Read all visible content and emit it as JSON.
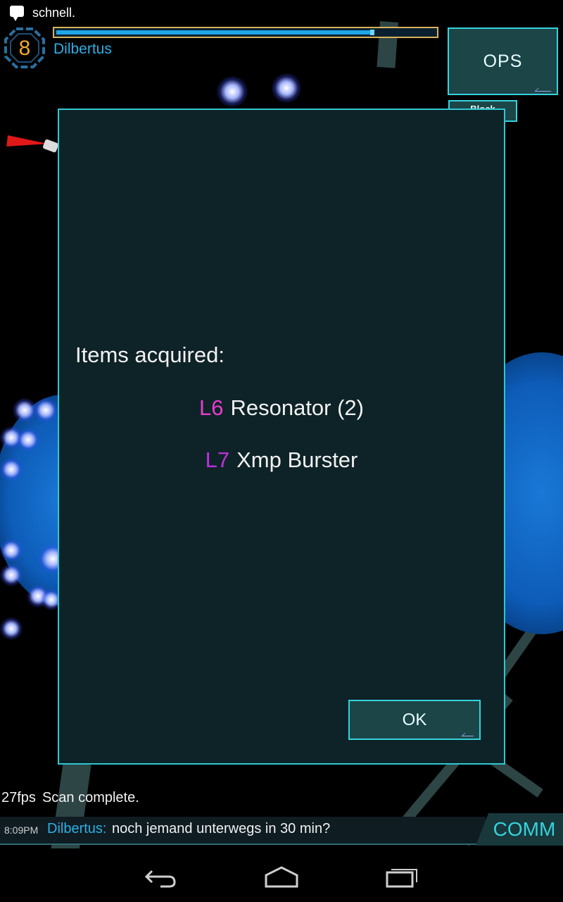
{
  "status_bar": {
    "notification_text": "schnell."
  },
  "agent": {
    "level": "8",
    "name": "Dilbertus",
    "xm_fill_fraction": 0.84
  },
  "buttons": {
    "ops_label": "OPS",
    "block_label": "Block",
    "comm_label": "COMM"
  },
  "dialog": {
    "title": "Items acquired:",
    "items": [
      {
        "level": "L6",
        "name": "Resonator (2)",
        "level_color": "#e83bcf"
      },
      {
        "level": "L7",
        "name": "Xmp Burster",
        "level_color": "#c02ee0"
      }
    ],
    "ok_label": "OK"
  },
  "hud": {
    "fps": "27fps",
    "scan_status": "Scan complete."
  },
  "comm": {
    "time": "8:09PM",
    "sender": "Dilbertus:",
    "message": "noch jemand unterwegs in 30 min?"
  },
  "nav": {
    "back_icon": "back-icon",
    "home_icon": "home-icon",
    "recents_icon": "recents-icon"
  },
  "colors": {
    "accent_cyan": "#35d2dc",
    "agent_blue": "#2dafe6",
    "level_orange": "#f2a92e",
    "xm_bar_border": "#d8b25a"
  }
}
